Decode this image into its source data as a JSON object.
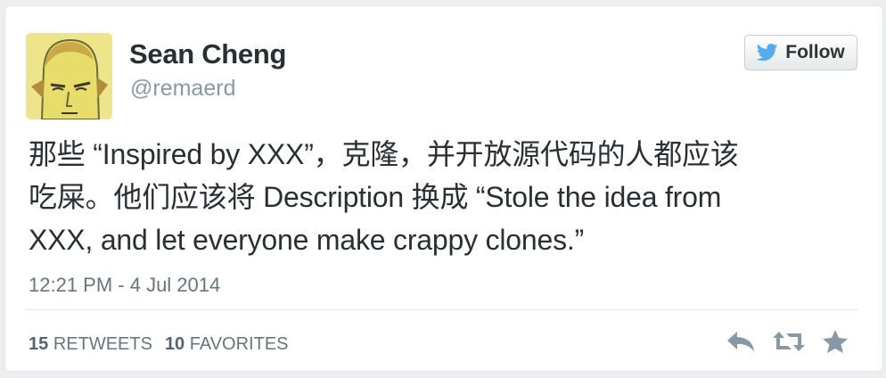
{
  "user": {
    "display_name": "Sean Cheng",
    "screen_name": "@remaerd"
  },
  "follow_button": {
    "label": "Follow",
    "icon": "twitter-bird-icon"
  },
  "tweet": {
    "lines": [
      "那些 “Inspired by XXX”，克隆，并开放源代码的人都应该",
      "吃屎。他们应该将 Description 换成 “Stole the idea from",
      "XXX, and let everyone make crappy clones.”"
    ],
    "timestamp": "12:21 PM - 4 Jul 2014"
  },
  "stats": {
    "retweets_count": "15",
    "retweets_label": "RETWEETS",
    "favorites_count": "10",
    "favorites_label": "FAVORITES"
  },
  "actions": [
    "reply-icon",
    "retweet-icon",
    "favorite-star-icon"
  ],
  "colors": {
    "twitter_blue": "#55acee",
    "text": "#292f33",
    "muted": "#8899a6",
    "icon_gray": "#8899a6"
  }
}
